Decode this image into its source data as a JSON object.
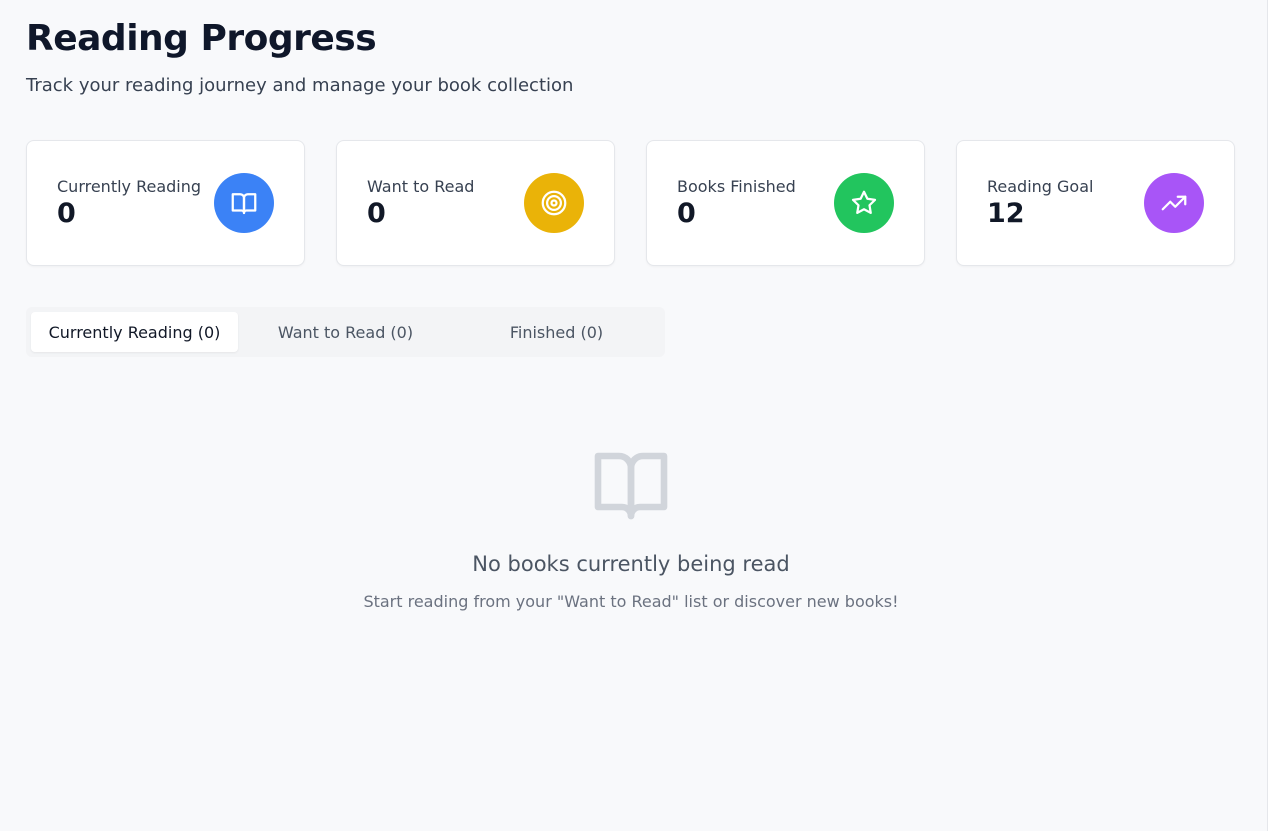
{
  "header": {
    "title": "Reading Progress",
    "subtitle": "Track your reading journey and manage your book collection"
  },
  "stats": [
    {
      "label": "Currently Reading",
      "value": "0",
      "icon": "book-open-icon",
      "color": "#3b82f6"
    },
    {
      "label": "Want to Read",
      "value": "0",
      "icon": "target-icon",
      "color": "#eab308"
    },
    {
      "label": "Books Finished",
      "value": "0",
      "icon": "star-icon",
      "color": "#22c55e"
    },
    {
      "label": "Reading Goal",
      "value": "12",
      "icon": "trending-up-icon",
      "color": "#a855f7"
    }
  ],
  "tabs": [
    {
      "label": "Currently Reading (0)",
      "active": true
    },
    {
      "label": "Want to Read (0)",
      "active": false
    },
    {
      "label": "Finished (0)",
      "active": false
    }
  ],
  "empty_state": {
    "icon": "book-open-icon",
    "title": "No books currently being read",
    "description": "Start reading from your \"Want to Read\" list or discover new books!"
  }
}
